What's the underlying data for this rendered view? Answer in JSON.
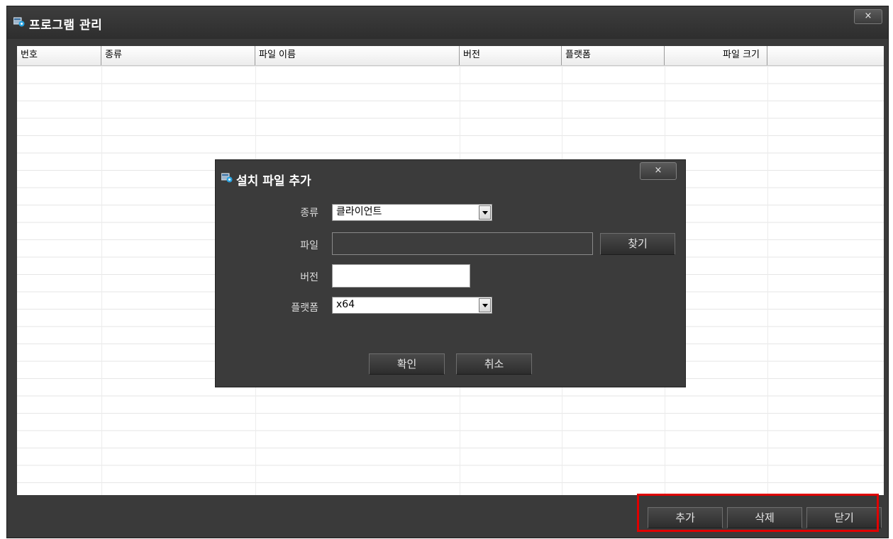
{
  "main_window": {
    "title": "프로그램 관리",
    "close_label": "×"
  },
  "grid": {
    "columns": [
      "번호",
      "종류",
      "파일 이름",
      "버전",
      "플랫폼",
      "파일 크기"
    ],
    "rows": []
  },
  "buttons": {
    "add": "추가",
    "delete": "삭제",
    "close": "닫기"
  },
  "dialog": {
    "title": "설치 파일 추가",
    "close_label": "×",
    "type_label": "종류",
    "type_value": "클라이언트",
    "file_label": "파일",
    "file_value": "",
    "browse_button": "찾기",
    "version_label": "버전",
    "version_value": "",
    "platform_label": "플랫폼",
    "platform_value": "x64",
    "ok_button": "확인",
    "cancel_button": "취소"
  },
  "colors": {
    "window_bg": "#3a3a3a",
    "highlight": "#e00000"
  },
  "icons": {
    "app": "settings-window-icon"
  }
}
